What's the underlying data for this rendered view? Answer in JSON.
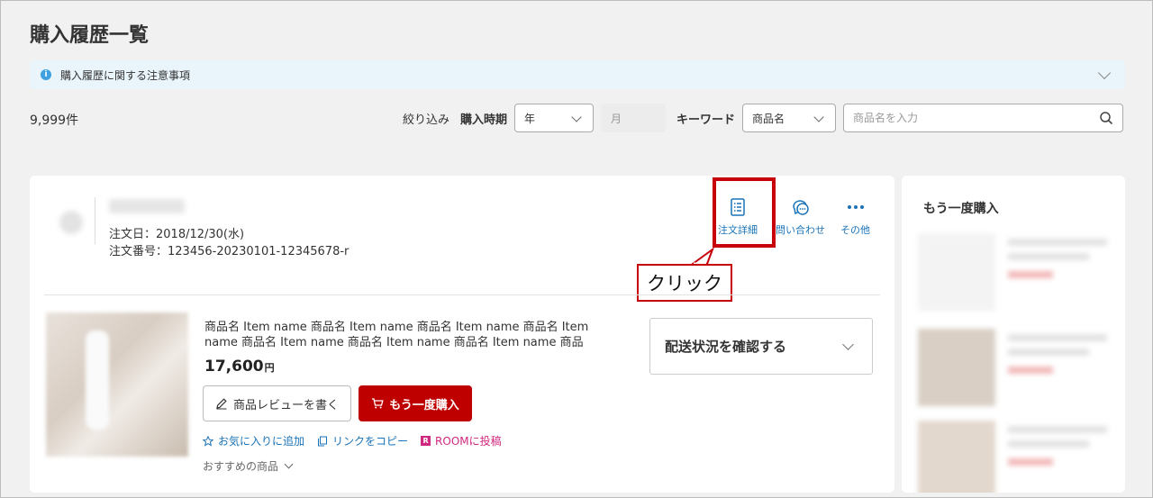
{
  "page": {
    "title": "購入履歴一覧"
  },
  "notice": {
    "text": "購入履歴に関する注意事項",
    "icon": "info-icon"
  },
  "results": {
    "count": "9,999件"
  },
  "filters": {
    "label": "絞り込み",
    "period_label": "購入時期",
    "year_value": "年",
    "month_value": "月",
    "keyword_label": "キーワード",
    "keyword_type": "商品名",
    "search_placeholder": "商品名を入力"
  },
  "order": {
    "date": "注文日：2018/12/30(水)",
    "number": "注文番号：123456-20230101-12345678-r",
    "actions": {
      "detail": "注文詳細",
      "inquiry": "問い合わせ",
      "more": "その他"
    },
    "product": {
      "name": "商品名 Item name 商品名 Item name 商品名 Item name 商品名 Item name 商品名 Item name 商品名 Item name 商品名 Item name 商品名…",
      "price": "17,600",
      "currency": "円"
    },
    "buttons": {
      "review": "商品レビューを書く",
      "rebuy": "もう一度購入"
    },
    "links": {
      "favorite": "お気に入りに追加",
      "copy": "リンクをコピー",
      "room": "ROOMに投稿"
    },
    "recommend": "おすすめの商品",
    "shipping": "配送状況を確認する"
  },
  "annotation": {
    "callout": "クリック"
  },
  "side_panel": {
    "title": "もう一度購入"
  },
  "colors": {
    "accent_red": "#bf0000",
    "link_blue": "#1a73b8",
    "highlight": "#c8000a",
    "room_pink": "#d0287e"
  }
}
